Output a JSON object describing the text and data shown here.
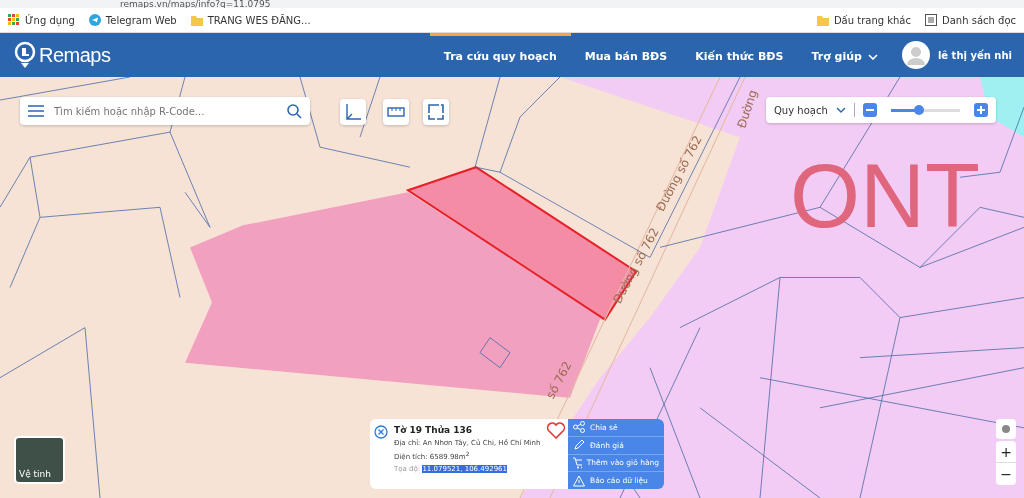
{
  "browser": {
    "url": "remaps.vn/maps/info?q=11.0795",
    "bookmarks": [
      {
        "label": "Ứng dụng",
        "kind": "apps"
      },
      {
        "label": "Telegram Web",
        "kind": "telegram"
      },
      {
        "label": "TRANG WES ĐĂNG...",
        "kind": "folder"
      }
    ],
    "bookmarks_right": [
      {
        "label": "Dấu trang khác",
        "kind": "folder"
      },
      {
        "label": "Danh sách đọc",
        "kind": "list"
      }
    ]
  },
  "header": {
    "logo": "Remaps",
    "nav": [
      {
        "label": "Tra cứu quy hoạch",
        "selected": true,
        "dropdown": false
      },
      {
        "label": "Mua bán BĐS",
        "selected": false,
        "dropdown": false
      },
      {
        "label": "Kiến thức BĐS",
        "selected": false,
        "dropdown": false
      },
      {
        "label": "Trợ giúp",
        "selected": false,
        "dropdown": true
      }
    ],
    "user": "lê thị yến nhi"
  },
  "search": {
    "placeholder": "Tìm kiếm hoặc nhập R-Code..."
  },
  "layer_control": {
    "layer": "Quy hoạch",
    "level": 0.4
  },
  "map": {
    "zone_label": "ONT",
    "road_labels": [
      "Đường",
      "Đường số 762",
      "Đường số 762",
      "số 762"
    ]
  },
  "basemap": {
    "label": "Vệ tinh"
  },
  "popup": {
    "title": "Tờ 19 Thửa 136",
    "address": "Địa chỉ: An Nhơn Tây, Củ Chi, Hồ Chí Minh",
    "area": "Diện tích: 6589.98m$^{2}$",
    "coords_label": "Tọa độ:",
    "coords": "11.079521, 106.492961",
    "favorite": false,
    "actions": [
      {
        "label": "Chia sẻ",
        "kind": "share"
      },
      {
        "label": "Đánh giá",
        "kind": "rate"
      },
      {
        "label": "Thêm vào giỏ hàng",
        "kind": "cart"
      },
      {
        "label": "Báo cáo dữ liệu",
        "kind": "report"
      }
    ]
  },
  "zoom": {
    "in": "+",
    "out": "−"
  }
}
